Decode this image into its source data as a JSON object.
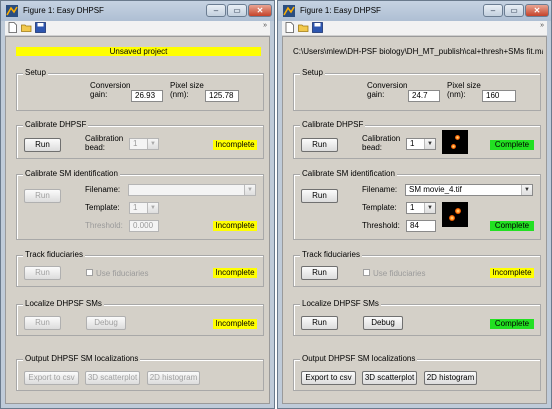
{
  "left_window": {
    "title": "Figure 1: Easy DHPSF",
    "banner": "Unsaved project",
    "setup": {
      "title": "Setup",
      "conv_label_1": "Conversion",
      "conv_label_2": "gain:",
      "conv_value": "26.93",
      "pix_label_1": "Pixel size",
      "pix_label_2": "(nm):",
      "pix_value": "125.78"
    },
    "calibrate": {
      "title": "Calibrate DHPSF",
      "run": "Run",
      "bead_label_1": "Calibration",
      "bead_label_2": "bead:",
      "bead_value": "1",
      "status": "Incomplete"
    },
    "sm_id": {
      "title": "Calibrate SM identification",
      "run": "Run",
      "filename_label": "Filename:",
      "filename_value": "",
      "template_label": "Template:",
      "template_value": "1",
      "threshold_label": "Threshold:",
      "threshold_value": "0.000",
      "status": "Incomplete"
    },
    "track": {
      "title": "Track fiduciaries",
      "run": "Run",
      "use_label": "Use fiduciaries",
      "status": "Incomplete"
    },
    "localize": {
      "title": "Localize DHPSF SMs",
      "run": "Run",
      "debug": "Debug",
      "status": "Incomplete"
    },
    "output": {
      "title": "Output DHPSF SM localizations",
      "export": "Export to csv",
      "scatter": "3D scatterplot",
      "histogram": "2D histogram"
    }
  },
  "right_window": {
    "title": "Figure 1: Easy DHPSF",
    "path": "C:\\Users\\mlew\\DH-PSF biology\\DH_MT_publish\\cal+thresh+SMs fit.mat",
    "setup": {
      "title": "Setup",
      "conv_label_1": "Conversion",
      "conv_label_2": "gain:",
      "conv_value": "24.7",
      "pix_label_1": "Pixel size",
      "pix_label_2": "(nm):",
      "pix_value": "160"
    },
    "calibrate": {
      "title": "Calibrate DHPSF",
      "run": "Run",
      "bead_label_1": "Calibration",
      "bead_label_2": "bead:",
      "bead_value": "1",
      "status": "Complete"
    },
    "sm_id": {
      "title": "Calibrate SM identification",
      "run": "Run",
      "filename_label": "Filename:",
      "filename_value": "SM movie_4.tif",
      "template_label": "Template:",
      "template_value": "1",
      "threshold_label": "Threshold:",
      "threshold_value": "84",
      "status": "Complete"
    },
    "track": {
      "title": "Track fiduciaries",
      "run": "Run",
      "use_label": "Use fiduciaries",
      "status": "Incomplete"
    },
    "localize": {
      "title": "Localize DHPSF SMs",
      "run": "Run",
      "debug": "Debug",
      "status": "Complete"
    },
    "output": {
      "title": "Output DHPSF SM localizations",
      "export": "Export to csv",
      "scatter": "3D scatterplot",
      "histogram": "2D histogram"
    }
  },
  "window_controls": {
    "minimize": "–",
    "maximize": "▭",
    "close": "✕",
    "toolbar_more": "»"
  },
  "icons": [
    "new-file-icon",
    "open-folder-icon",
    "save-disk-icon",
    "matlab-figure-icon"
  ],
  "colors": {
    "incomplete": "#ffff00",
    "complete": "#22e022",
    "banner": "#ffff00"
  }
}
